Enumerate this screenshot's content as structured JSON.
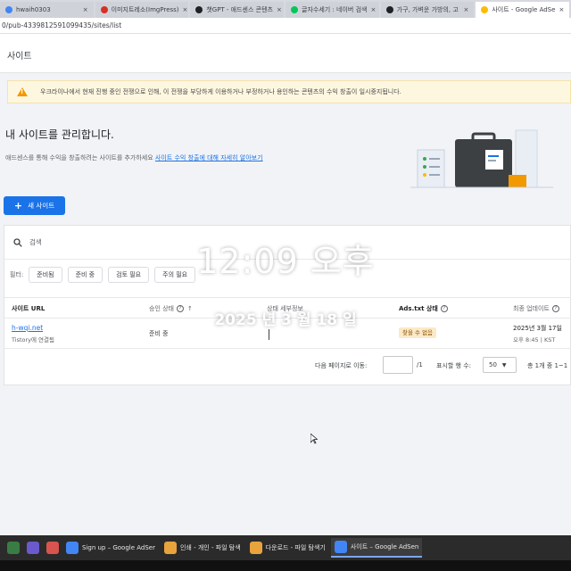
{
  "browser": {
    "tabs": [
      {
        "label": "hwaih0303",
        "color": "#4285f4",
        "active": false
      },
      {
        "label": "이미지트레소(ImgPress)",
        "color": "#d93025",
        "active": false
      },
      {
        "label": "챗GPT - 애드센스 콘텐츠",
        "color": "#202124",
        "active": false
      },
      {
        "label": "글자수세기 : 네이버 검색",
        "color": "#03c75a",
        "active": false
      },
      {
        "label": "가구, 가벼운 가방의, 고",
        "color": "#202124",
        "active": false
      },
      {
        "label": "사이트 - Google AdSe",
        "color": "#fbbc04",
        "active": true
      }
    ],
    "address": "0/pub-4339812591099435/sites/list"
  },
  "page": {
    "header": "사이트",
    "banner": "우크라이나에서 현재 진행 중인 전쟁으로 인해, 이 전쟁을 부당하게 이용하거나 부정하거나 용인하는 콘텐츠의 수익 창출이 일시중지됩니다.",
    "manage_title": "내 사이트를 관리합니다.",
    "manage_sub": "애드센스를 통해 수익을 창출하려는 사이트를 추가하세요",
    "manage_link": "사이트 수익 창출에 대해 자세히 알아보기",
    "new_site_button": "새 사이트",
    "search_placeholder": "검색",
    "filter_label": "필터:",
    "filters": [
      "준비됨",
      "준비 중",
      "검토 필요",
      "주의 필요"
    ],
    "columns": {
      "site_url": "사이트 URL",
      "approval": "승인 상태",
      "details": "상태 세부정보",
      "ads_txt": "Ads.txt 상태",
      "updated": "최종 업데이트"
    },
    "rows": [
      {
        "site": "h-wqi.net",
        "site_sub": "Tistory에 연결됨",
        "approval": "준비 중",
        "ads_txt": "찾을 수 없음",
        "updated": "2025년 3월 17일",
        "updated_time": "오후 8:45 | KST"
      }
    ],
    "pagination": {
      "goto_label": "다음 페이지로 이동:",
      "page_total": "/1",
      "rows_label": "표시할 행 수:",
      "rows_value": "50",
      "range_text": "총 1개 중 1~1"
    }
  },
  "overlay": {
    "time": "12:09 오후",
    "date": "2025 년 3 월 18 일"
  },
  "taskbar": {
    "items": [
      {
        "label": "Sign up – Google AdSer",
        "color": "#4285f4",
        "active": false
      },
      {
        "label": "인쇄 - 개인 - 파일 탐색",
        "color": "#e8a33c",
        "active": false
      },
      {
        "label": "다운로드 - 파일 탐색기",
        "color": "#e8a33c",
        "active": false
      },
      {
        "label": "사이트 – Google AdSen",
        "color": "#4285f4",
        "active": true
      }
    ]
  },
  "colors": {
    "accent": "#1a73e8",
    "warning": "#f29900",
    "banner_bg": "#fef7e0"
  }
}
